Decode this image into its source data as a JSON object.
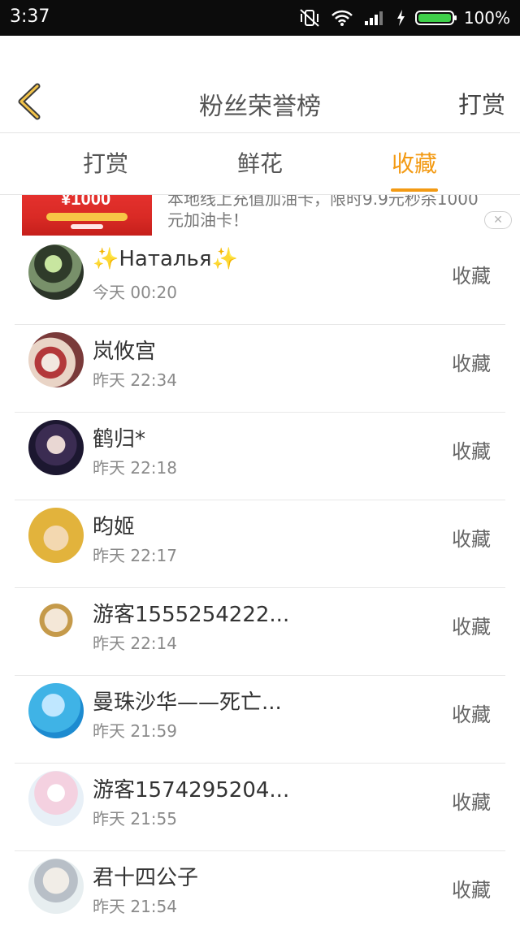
{
  "status_bar": {
    "time": "3:37",
    "battery": "100%",
    "icons": [
      "mute-vibrate-icon",
      "wifi-icon",
      "signal-icon",
      "charging-icon",
      "battery-icon"
    ],
    "battery_color": "#3fd04a"
  },
  "header": {
    "title": "粉丝荣誉榜",
    "action": "打赏",
    "back_icon": "chevron-left-icon"
  },
  "tabs": [
    {
      "label": "打赏",
      "active": false
    },
    {
      "label": "鲜花",
      "active": false
    },
    {
      "label": "收藏",
      "active": true
    }
  ],
  "accent_color": "#f39a13",
  "ad": {
    "image_text": "¥1000",
    "text": "本地线上充值加油卡，限时9.9元秒杀1000元加油卡！",
    "close_icon": "close-icon"
  },
  "list": [
    {
      "name_pre": "✨",
      "name": "Наталья",
      "name_post": "✨",
      "time": "今天 00:20",
      "type": "收藏"
    },
    {
      "name_pre": "",
      "name": "岚攸宫",
      "name_post": "",
      "time": "昨天 22:34",
      "type": "收藏"
    },
    {
      "name_pre": "",
      "name": "鹤归*",
      "name_post": "",
      "time": "昨天 22:18",
      "type": "收藏"
    },
    {
      "name_pre": "",
      "name": "昀姬",
      "name_post": "",
      "time": "昨天 22:17",
      "type": "收藏"
    },
    {
      "name_pre": "",
      "name": "游客1555254222...",
      "name_post": "",
      "time": "昨天 22:14",
      "type": "收藏"
    },
    {
      "name_pre": "",
      "name": "曼珠沙华——死亡...",
      "name_post": "",
      "time": "昨天 21:59",
      "type": "收藏"
    },
    {
      "name_pre": "",
      "name": "游客1574295204...",
      "name_post": "",
      "time": "昨天 21:55",
      "type": "收藏"
    },
    {
      "name_pre": "",
      "name": "君十四公子",
      "name_post": "",
      "time": "昨天 21:54",
      "type": "收藏"
    }
  ]
}
